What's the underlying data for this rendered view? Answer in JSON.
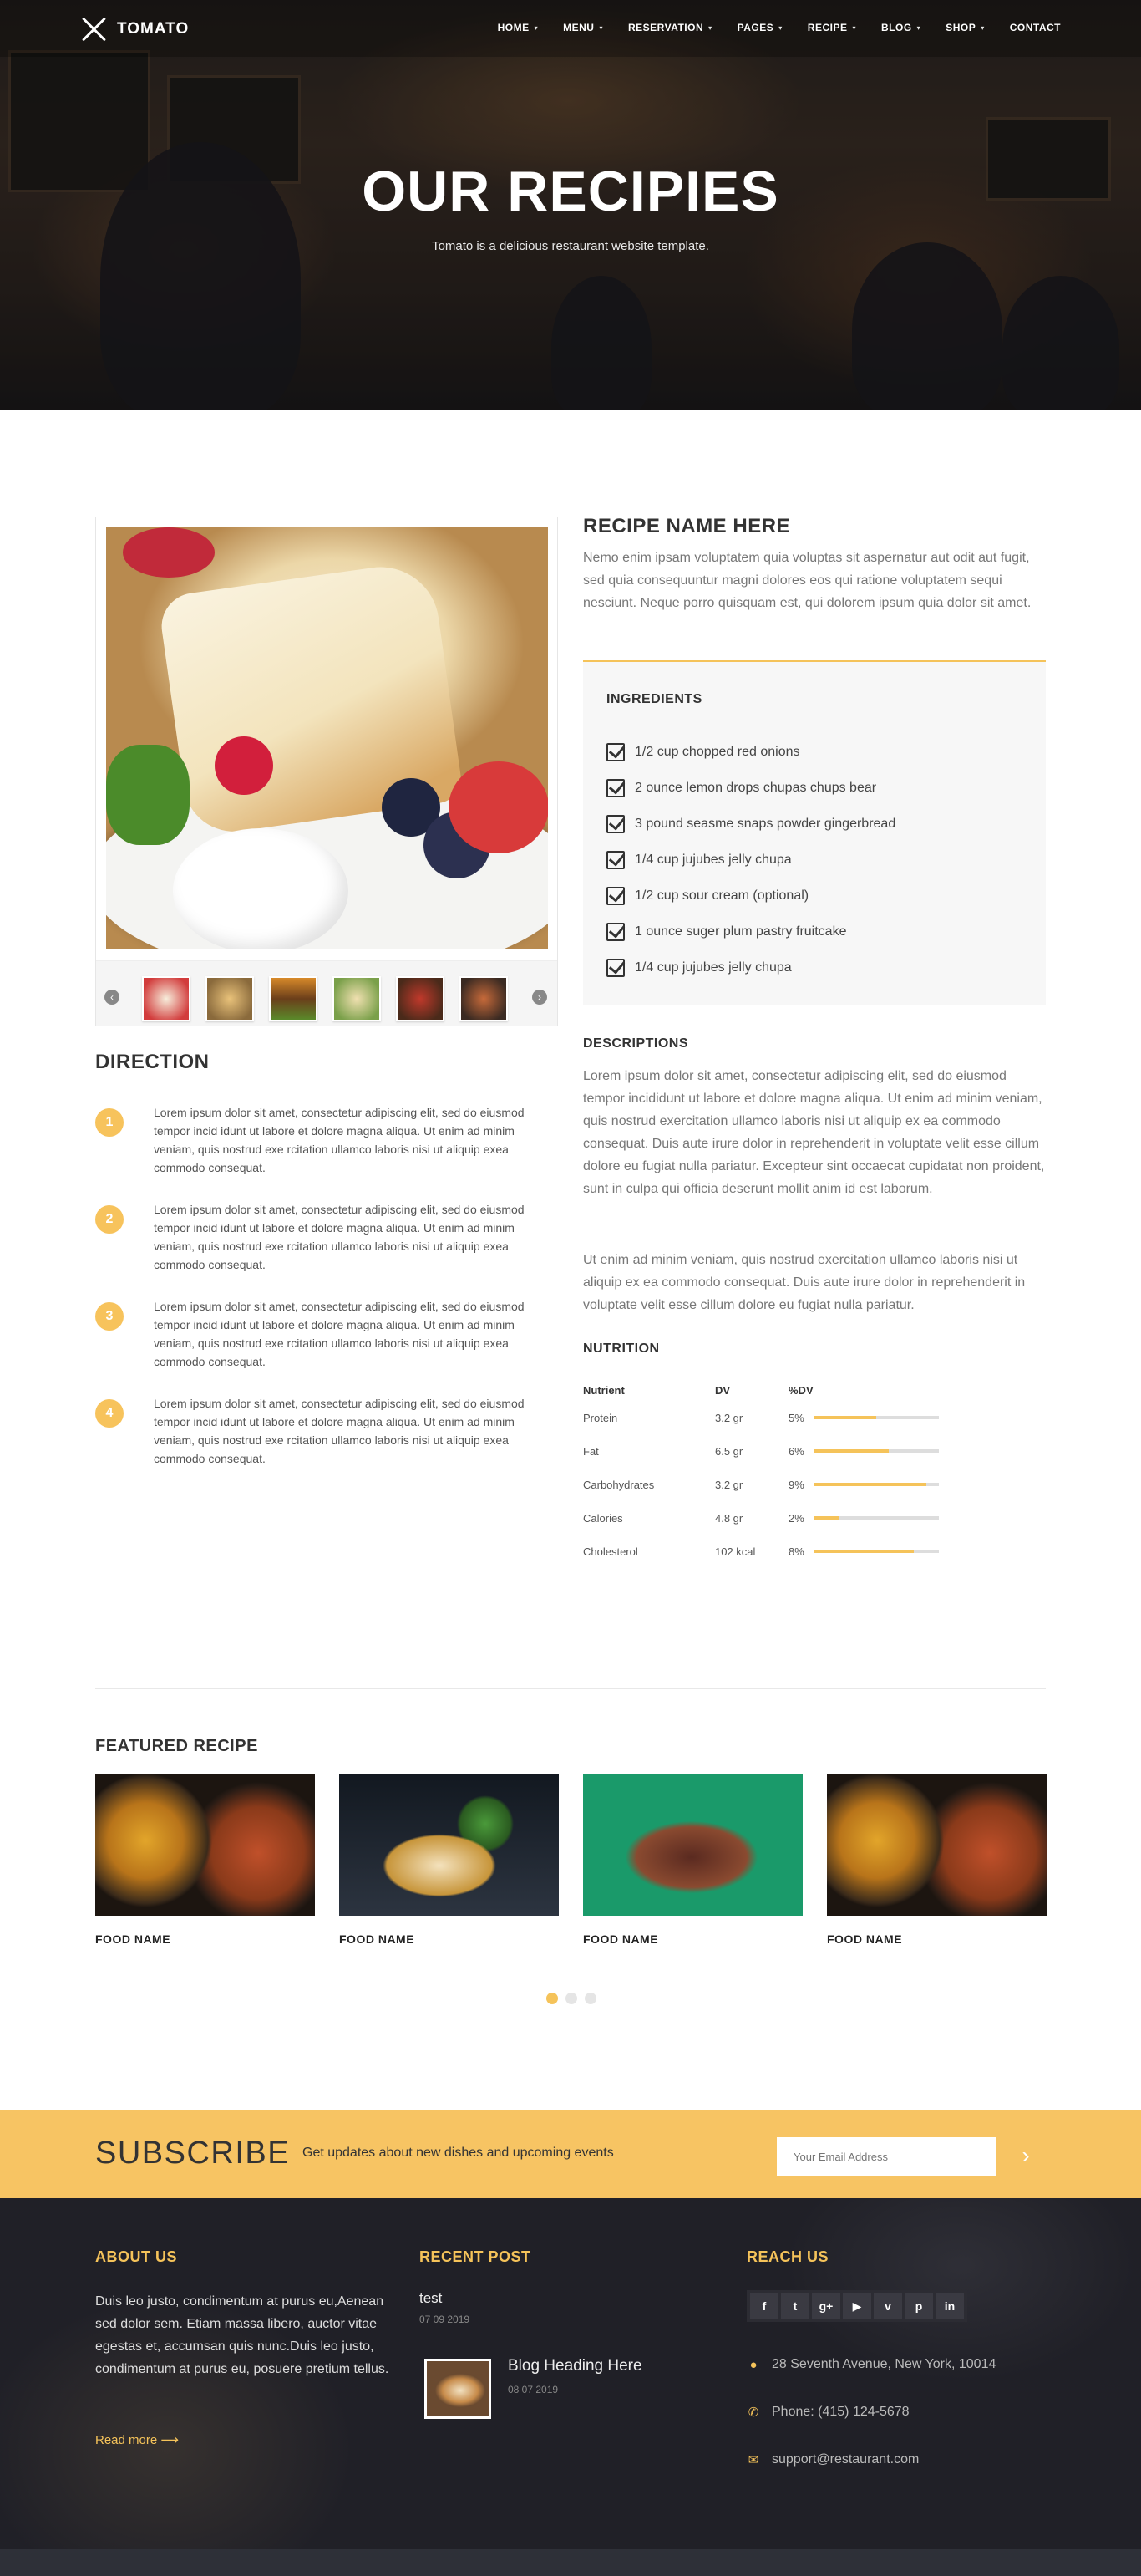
{
  "brand": {
    "name": "TOMATO"
  },
  "nav": [
    {
      "label": "HOME",
      "caret": true
    },
    {
      "label": "MENU",
      "caret": true
    },
    {
      "label": "RESERVATION",
      "caret": true
    },
    {
      "label": "PAGES",
      "caret": true
    },
    {
      "label": "RECIPE",
      "caret": true
    },
    {
      "label": "BLOG",
      "caret": true
    },
    {
      "label": "SHOP",
      "caret": true
    },
    {
      "label": "CONTACT",
      "caret": false
    }
  ],
  "hero": {
    "title": "OUR RECIPIES",
    "subtitle": "Tomato is a delicious restaurant website template."
  },
  "recipe": {
    "name": "RECIPE NAME HERE",
    "intro": "Nemo enim ipsam voluptatem quia voluptas sit aspernatur aut odit aut fugit, sed quia consequuntur magni dolores eos qui ratione voluptatem sequi nesciunt. Neque porro quisquam est, qui dolorem ipsum quia dolor sit amet.",
    "ingredients_title": "INGREDIENTS",
    "ingredients": [
      "1/2 cup chopped red onions",
      "2 ounce lemon drops chupas chups bear",
      "3 pound seasme snaps powder gingerbread",
      "1/4 cup jujubes jelly chupa",
      "1/2 cup sour cream (optional)",
      "1 ounce suger plum pastry fruitcake",
      "1/4 cup jujubes jelly chupa"
    ],
    "descriptions_title": "DESCRIPTIONS",
    "descriptions": [
      "Lorem ipsum dolor sit amet, consectetur adipiscing elit, sed do eiusmod tempor incididunt ut labore et dolore magna aliqua. Ut enim ad minim veniam, quis nostrud exercitation ullamco laboris nisi ut aliquip ex ea commodo consequat. Duis aute irure dolor in reprehenderit in voluptate velit esse cillum dolore eu fugiat nulla pariatur. Excepteur sint occaecat cupidatat non proident, sunt in culpa qui officia deserunt mollit anim id est laborum.",
      "Ut enim ad minim veniam, quis nostrud exercitation ullamco laboris nisi ut aliquip ex ea commodo consequat. Duis aute irure dolor in reprehenderit in voluptate velit esse cillum dolore eu fugiat nulla pariatur."
    ],
    "nutrition_title": "NUTRITION",
    "nutrition_headers": [
      "Nutrient",
      "DV",
      "%DV"
    ],
    "nutrition": [
      {
        "nutrient": "Protein",
        "dv": "3.2 gr",
        "pct": "5%",
        "fill": 0.5
      },
      {
        "nutrient": "Fat",
        "dv": "6.5 gr",
        "pct": "6%",
        "fill": 0.6
      },
      {
        "nutrient": "Carbohydrates",
        "dv": "3.2 gr",
        "pct": "9%",
        "fill": 0.9
      },
      {
        "nutrient": "Calories",
        "dv": "4.8 gr",
        "pct": "2%",
        "fill": 0.2
      },
      {
        "nutrient": "Cholesterol",
        "dv": "102 kcal",
        "pct": "8%",
        "fill": 0.8
      }
    ]
  },
  "direction": {
    "title": "DIRECTION",
    "steps": [
      {
        "num": "1",
        "text": "Lorem ipsum dolor sit amet, consectetur adipiscing elit, sed do eiusmod tempor incid idunt ut labore et dolore magna aliqua. Ut enim ad minim veniam, quis nostrud exe rcitation ullamco laboris nisi ut aliquip exea commodo consequat."
      },
      {
        "num": "2",
        "text": "Lorem ipsum dolor sit amet, consectetur adipiscing elit, sed do eiusmod tempor incid idunt ut labore et dolore magna aliqua. Ut enim ad minim veniam, quis nostrud exe rcitation ullamco laboris nisi ut aliquip exea commodo consequat."
      },
      {
        "num": "3",
        "text": "Lorem ipsum dolor sit amet, consectetur adipiscing elit, sed do eiusmod tempor incid idunt ut labore et dolore magna aliqua. Ut enim ad minim veniam, quis nostrud exe rcitation ullamco laboris nisi ut aliquip exea commodo consequat."
      },
      {
        "num": "4",
        "text": "Lorem ipsum dolor sit amet, consectetur adipiscing elit, sed do eiusmod tempor incid idunt ut labore et dolore magna aliqua. Ut enim ad minim veniam, quis nostrud exe rcitation ullamco laboris nisi ut aliquip exea commodo consequat."
      }
    ]
  },
  "featured": {
    "title": "FEATURED RECIPE",
    "items": [
      {
        "name": "FOOD NAME"
      },
      {
        "name": "FOOD NAME"
      },
      {
        "name": "FOOD NAME"
      },
      {
        "name": "FOOD NAME"
      }
    ]
  },
  "subscribe": {
    "title": "SUBSCRIBE",
    "text": "Get updates about new dishes and upcoming events",
    "placeholder": "Your Email Address",
    "button": "›"
  },
  "footer": {
    "about_title": "ABOUT US",
    "about_text": "Duis leo justo, condimentum at purus eu,Aenean sed dolor sem. Etiam massa libero, auctor vitae egestas et, accumsan quis nunc.Duis leo justo, condimentum at purus eu, posuere pretium tellus.",
    "read_more": "Read more ⟶",
    "recent_title": "RECENT POST",
    "posts": [
      {
        "title": "test",
        "date": "07 09 2019"
      },
      {
        "title": "Blog Heading Here",
        "date": "08 07 2019"
      }
    ],
    "reach_title": "REACH US",
    "social": [
      "f",
      "t",
      "g+",
      "▶",
      "v",
      "p",
      "in"
    ],
    "address": "28 Seventh Avenue, New York, 10014",
    "phone": "Phone: (415) 124-5678",
    "email": "support@restaurant.com"
  },
  "colors": {
    "accent": "#f5c35a",
    "footer_bg": "#202027",
    "subscribe_bg": "#f7c463"
  }
}
